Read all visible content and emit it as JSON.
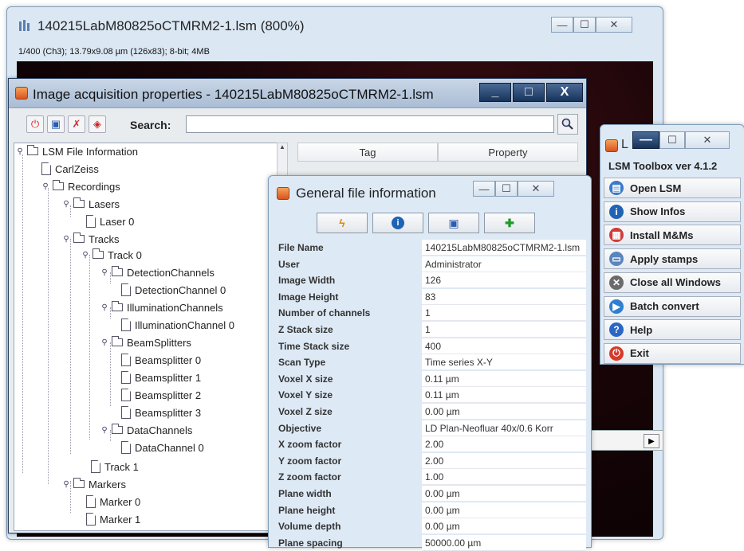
{
  "image_window": {
    "title": "140215LabM80825oCTMRM2-1.lsm (800%)",
    "info": "1/400 (Ch3); 13.79x9.08 µm (126x83); 8-bit; 4MB",
    "buttons": {
      "minimize": "—",
      "maximize": "☐",
      "close": "✕"
    }
  },
  "acq_window": {
    "title": "Image acquisition properties - 140215LabM80825oCTMRM2-1.lsm",
    "buttons": {
      "minimize": "_",
      "maximize": "□",
      "close": "X"
    },
    "search_label": "Search:",
    "search_value": "",
    "table_headers": [
      "Tag",
      "Property"
    ],
    "tree": {
      "root": "LSM File Information",
      "carlzeiss": "CarlZeiss",
      "recordings": "Recordings",
      "lasers": "Lasers",
      "laser0": "Laser 0",
      "tracks": "Tracks",
      "track0": "Track 0",
      "detection_channels": "DetectionChannels",
      "detection_channel0": "DetectionChannel 0",
      "illumination_channels": "IlluminationChannels",
      "illumination_channel0": "IlluminationChannel 0",
      "beam_splitters": "BeamSplitters",
      "beamsplitter0": "Beamsplitter 0",
      "beamsplitter1": "Beamsplitter 1",
      "beamsplitter2": "Beamsplitter 2",
      "beamsplitter3": "Beamsplitter 3",
      "data_channels": "DataChannels",
      "data_channel0": "DataChannel 0",
      "track1": "Track 1",
      "markers": "Markers",
      "marker0": "Marker 0",
      "marker1": "Marker 1"
    }
  },
  "file_info_window": {
    "title": "General file information",
    "buttons": {
      "minimize": "—",
      "maximize": "☐",
      "close": "✕"
    },
    "rows": [
      {
        "key": "File Name",
        "value": "140215LabM80825oCTMRM2-1.lsm"
      },
      {
        "key": "User",
        "value": "Administrator"
      },
      {
        "key": "Image Width",
        "value": "126"
      },
      {
        "key": "Image Height",
        "value": "83"
      },
      {
        "key": "Number of channels",
        "value": "1"
      },
      {
        "key": "Z Stack size",
        "value": "1"
      },
      {
        "key": "Time Stack size",
        "value": "400"
      },
      {
        "key": "Scan Type",
        "value": "Time series X-Y"
      },
      {
        "key": "Voxel X size",
        "value": "0.11 µm"
      },
      {
        "key": "Voxel Y size",
        "value": "0.11 µm"
      },
      {
        "key": "Voxel Z size",
        "value": "0.00 µm"
      },
      {
        "key": "Objective",
        "value": "LD Plan-Neofluar 40x/0.6 Korr"
      },
      {
        "key": "X zoom factor",
        "value": "2.00"
      },
      {
        "key": "Y zoom factor",
        "value": "2.00"
      },
      {
        "key": "Z zoom factor",
        "value": "1.00"
      },
      {
        "key": "Plane width",
        "value": "0.00 µm"
      },
      {
        "key": "Plane height",
        "value": "0.00 µm"
      },
      {
        "key": "Volume depth",
        "value": "0.00 µm"
      },
      {
        "key": "Plane spacing",
        "value": "50000.00 µm"
      }
    ]
  },
  "toolbox": {
    "title": "L",
    "buttons": {
      "minimize": "—",
      "maximize": "☐",
      "close": "✕"
    },
    "version": "LSM Toolbox  ver 4.1.2",
    "items": [
      {
        "label": "Open LSM",
        "icon": "open-lsm-icon",
        "color": "#3a7ac9"
      },
      {
        "label": "Show Infos",
        "icon": "info-icon",
        "color": "#1f63b5"
      },
      {
        "label": "Install M&Ms",
        "icon": "mms-icon",
        "color": "#d23a3a"
      },
      {
        "label": "Apply stamps",
        "icon": "stamp-icon",
        "color": "#5a86c0"
      },
      {
        "label": "Close all Windows",
        "icon": "close-all-icon",
        "color": "#6b6b6b"
      },
      {
        "label": "Batch convert",
        "icon": "batch-convert-icon",
        "color": "#2e7fd2"
      },
      {
        "label": "Help",
        "icon": "help-icon",
        "color": "#2a66c4"
      },
      {
        "label": "Exit",
        "icon": "exit-icon",
        "color": "#d63a2a"
      }
    ]
  }
}
